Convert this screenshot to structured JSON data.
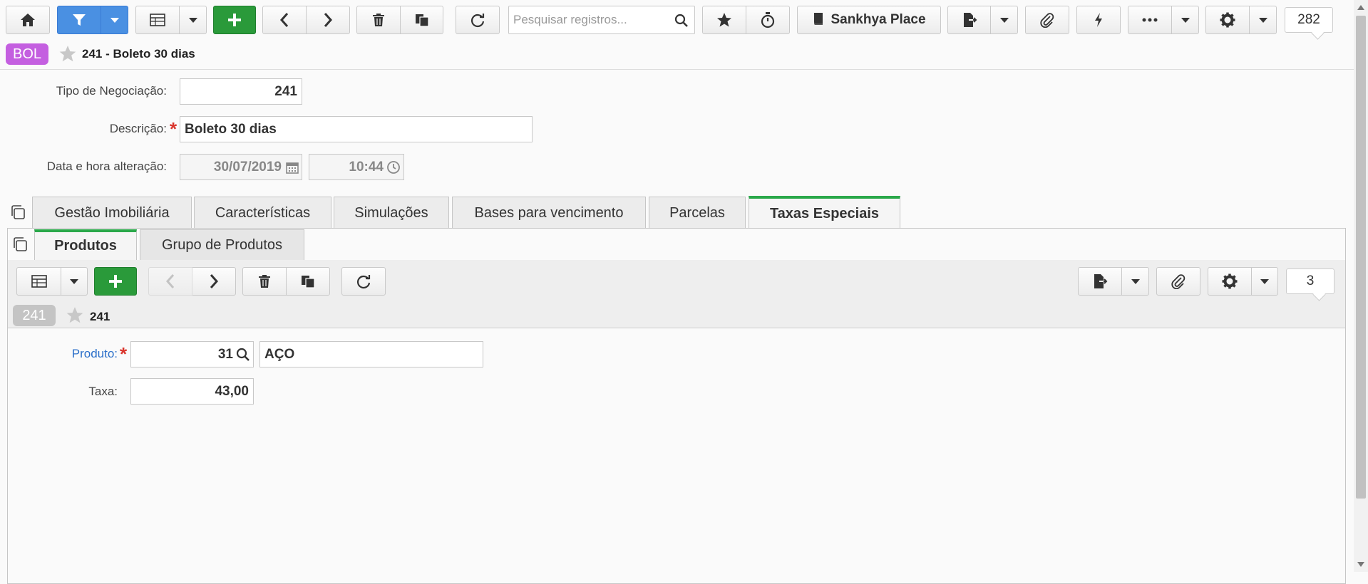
{
  "toolbar": {
    "search_placeholder": "Pesquisar registros...",
    "place_label": "Sankhya Place",
    "record_count": "282"
  },
  "header": {
    "badge": "BOL",
    "title": "241 - Boleto 30 dias",
    "badge_color": "#c45fe0"
  },
  "form": {
    "tipo_label": "Tipo de Negociação:",
    "tipo_value": "241",
    "descricao_label": "Descrição:",
    "descricao_value": "Boleto 30 dias",
    "data_label": "Data e hora alteração:",
    "data_value": "30/07/2019",
    "hora_value": "10:44"
  },
  "tabs": [
    {
      "label": "Gestão Imobiliária"
    },
    {
      "label": "Características"
    },
    {
      "label": "Simulações"
    },
    {
      "label": "Bases para vencimento"
    },
    {
      "label": "Parcelas"
    },
    {
      "label": "Taxas Especiais"
    }
  ],
  "subtabs": [
    {
      "label": "Produtos"
    },
    {
      "label": "Grupo de Produtos"
    }
  ],
  "sub": {
    "record_count": "3",
    "badge": "241",
    "title": "241",
    "produto_label": "Produto:",
    "produto_code": "31",
    "produto_name": "AÇO",
    "taxa_label": "Taxa:",
    "taxa_value": "43,00"
  },
  "colors": {
    "accent_blue": "#4a90e2",
    "accent_green": "#2a9a3a",
    "active_tab_bar": "#2aa84a",
    "required": "#d9342b"
  }
}
